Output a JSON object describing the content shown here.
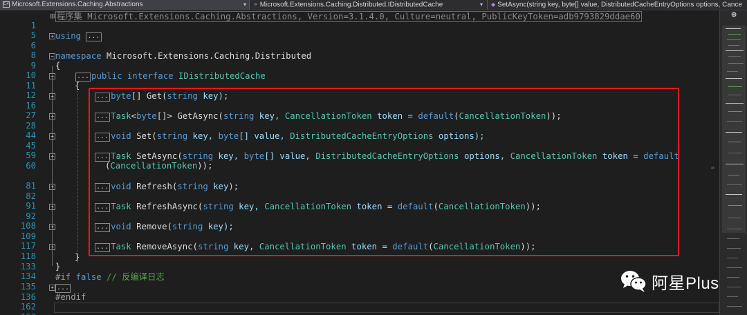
{
  "navbar": {
    "project": "Microsoft.Extensions.Caching.Abstractions",
    "type": "Microsoft.Extensions.Caching.Distributed.IDistributedCache",
    "member": "SetAsync(string key, byte[] value, DistributedCacheEntryOptions options, Cance"
  },
  "ellipsis": "...",
  "lines": {
    "l1": {
      "num": "1",
      "fold": "⊞",
      "assembly": "程序集 Microsoft.Extensions.Caching.Abstractions, Version=3.1.4.0, Culture=neutral, PublicKeyToken=adb9793829ddae60"
    },
    "l5": {
      "num": "5"
    },
    "l6": {
      "num": "6",
      "fold": "+",
      "kw": "using"
    },
    "l8": {
      "num": "8"
    },
    "l9": {
      "num": "9",
      "fold": "−",
      "kw": "namespace",
      "name": " Microsoft.Extensions.Caching.Distributed"
    },
    "l10": {
      "num": "10",
      "text": "{"
    },
    "l11": {
      "num": "11",
      "fold": "−",
      "kw1": "public",
      "kw2": " interface",
      "name": " IDistributedCache"
    },
    "l12": {
      "num": "12",
      "text": "{"
    },
    "l16": {
      "num": "16",
      "fold": "+",
      "t1": "byte",
      "t2": "[] Get(",
      "t3": "string",
      "t4": " key);"
    },
    "l27": {
      "num": "27"
    },
    "l28": {
      "num": "28",
      "fold": "+",
      "a": "Task",
      "b": "<",
      "c": "byte",
      "d": "[]> GetAsync(",
      "e": "string",
      "f": " key, ",
      "g": "CancellationToken",
      "h": " token = ",
      "i": "default",
      "j": "(",
      "k": "CancellationToken",
      "l": "));"
    },
    "l44": {
      "num": "44"
    },
    "l45": {
      "num": "45",
      "fold": "+",
      "a": "void",
      "b": " Set(",
      "c": "string",
      "d": " key, ",
      "e": "byte",
      "f": "[] value, ",
      "g": "DistributedCacheEntryOptions",
      "h": " options);"
    },
    "l59": {
      "num": "59"
    },
    "l60": {
      "num": "60",
      "fold": "+",
      "a": "Task",
      "b": " SetAsync(",
      "c": "string",
      "d": " key, ",
      "e": "byte",
      "f": "[] value, ",
      "g": "DistributedCacheEntryOptions",
      "h": " options, ",
      "i": "CancellationToken",
      "j": " token = ",
      "k": "default"
    },
    "l60b": {
      "a": "(",
      "b": "CancellationToken",
      "c": "));"
    },
    "l81": {
      "num": "81"
    },
    "l82": {
      "num": "82",
      "fold": "+",
      "a": "void",
      "b": " Refresh(",
      "c": "string",
      "d": " key);"
    },
    "l91": {
      "num": "91"
    },
    "l92": {
      "num": "92",
      "fold": "+",
      "a": "Task",
      "b": " RefreshAsync(",
      "c": "string",
      "d": " key, ",
      "e": "CancellationToken",
      "f": " token = ",
      "g": "default",
      "h": "(",
      "i": "CancellationToken",
      "j": "));"
    },
    "l108": {
      "num": "108"
    },
    "l109": {
      "num": "109",
      "fold": "+",
      "a": "void",
      "b": " Remove(",
      "c": "string",
      "d": " key);"
    },
    "l117": {
      "num": "117"
    },
    "l118": {
      "num": "118",
      "fold": "+",
      "a": "Task",
      "b": " RemoveAsync(",
      "c": "string",
      "d": " key, ",
      "e": "CancellationToken",
      "f": " token = ",
      "g": "default",
      "h": "(",
      "i": "CancellationToken",
      "j": "));"
    },
    "l133": {
      "num": "133",
      "text": "}"
    },
    "l134": {
      "num": "134",
      "text": "}"
    },
    "l135": {
      "num": "135",
      "pp": "#if",
      "kw": " false",
      "cm": " // 反编译日志"
    },
    "l136": {
      "num": "136",
      "fold": "+"
    },
    "l162": {
      "num": "162",
      "pp": "#endif"
    },
    "l163": {
      "num": "163"
    }
  },
  "watermark": {
    "text": "阿星Plus"
  },
  "icons": {
    "split": "⊕",
    "dropdown": "▾"
  },
  "colors": {
    "background": "#1e1e1e",
    "keyword": "#569cd6",
    "type": "#4ec9b0",
    "parameter": "#9cdcfe",
    "line_number": "#2b91af",
    "highlight": "#e3191b"
  }
}
